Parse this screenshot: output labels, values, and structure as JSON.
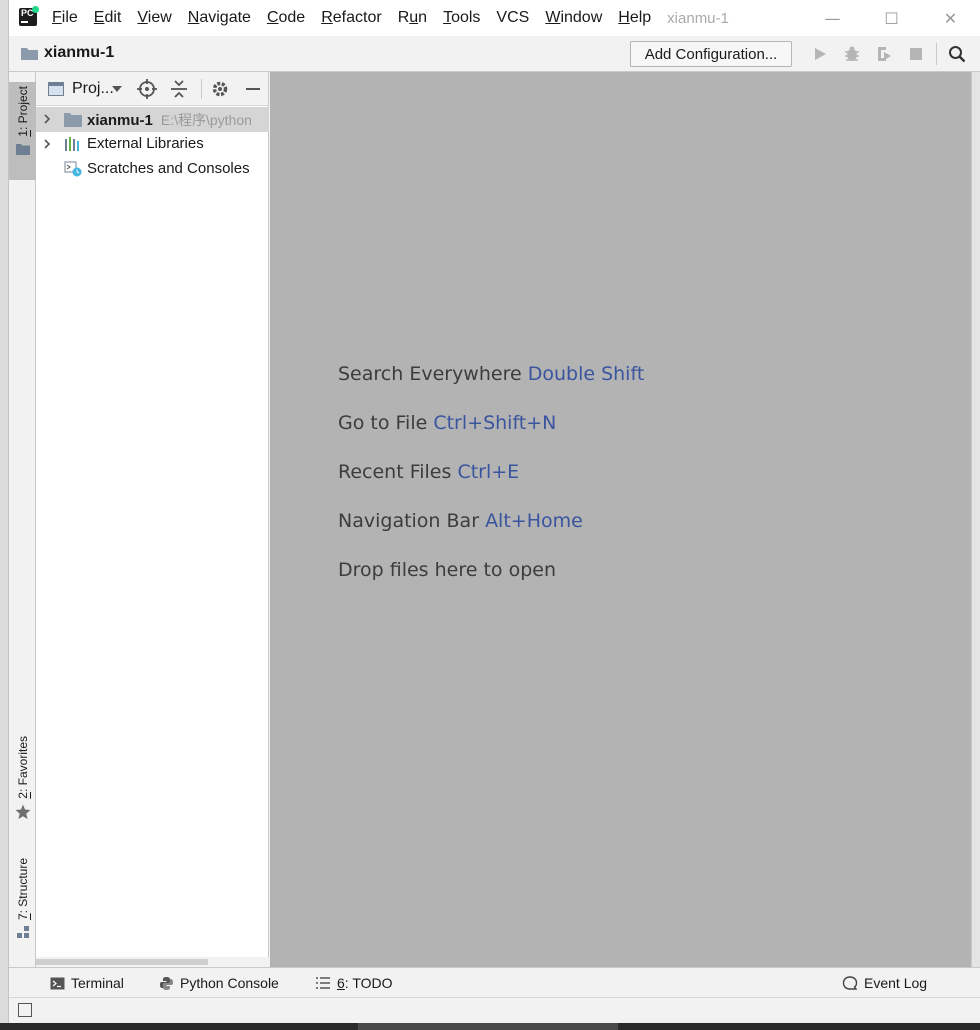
{
  "menu": {
    "items": [
      {
        "key": "F",
        "rest": "ile"
      },
      {
        "key": "E",
        "rest": "dit"
      },
      {
        "key": "V",
        "rest": "iew"
      },
      {
        "key": "N",
        "rest": "avigate"
      },
      {
        "key": "C",
        "rest": "ode"
      },
      {
        "key": "R",
        "rest": "efactor"
      },
      {
        "pre": "R",
        "key": "u",
        "rest": "n"
      },
      {
        "key": "T",
        "rest": "ools"
      },
      {
        "plain": "VCS"
      },
      {
        "key": "W",
        "rest": "indow"
      },
      {
        "key": "H",
        "rest": "elp"
      }
    ],
    "project_title": "xianmu-1"
  },
  "window_controls": {
    "minimize": "—",
    "maximize": "☐",
    "close": "✕"
  },
  "navbar": {
    "project_name": "xianmu-1",
    "add_configuration": "Add Configuration..."
  },
  "tool_strip": {
    "project_tab": {
      "num": "1",
      "label": ": Project"
    },
    "favorites_tab": {
      "num": "2",
      "label": ": Favorites"
    },
    "structure_tab": {
      "num": "7",
      "label": ": Structure"
    }
  },
  "project_panel": {
    "view_label": "Proj...",
    "tree": [
      {
        "label": "xianmu-1",
        "path": "E:\\程序\\python",
        "selected": true,
        "expandable": true,
        "icon": "folder-icon"
      },
      {
        "label": "External Libraries",
        "selected": false,
        "expandable": true,
        "icon": "library-icon"
      },
      {
        "label": "Scratches and Consoles",
        "selected": false,
        "expandable": false,
        "icon": "scratches-icon"
      }
    ]
  },
  "editor": {
    "hints": [
      {
        "text": "Search Everywhere",
        "key": "Double Shift"
      },
      {
        "text": "Go to File",
        "key": "Ctrl+Shift+N"
      },
      {
        "text": "Recent Files",
        "key": "Ctrl+E"
      },
      {
        "text": "Navigation Bar",
        "key": "Alt+Home"
      },
      {
        "text": "Drop files here to open",
        "key": ""
      }
    ]
  },
  "bottom_tools": {
    "terminal": "Terminal",
    "python_console": "Python Console",
    "todo": {
      "num": "6",
      "label": ": TODO"
    },
    "event_log": "Event Log"
  },
  "colors": {
    "editor_bg": "#b3b3b3",
    "shortcut_key": "#3a55a0",
    "selection": "#d5d5d5",
    "panel_bg": "#f2f2f2"
  }
}
